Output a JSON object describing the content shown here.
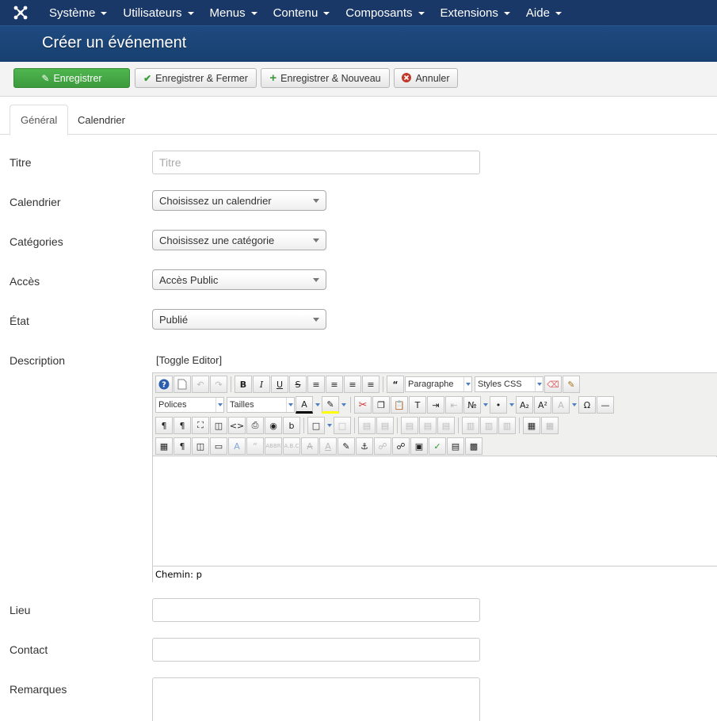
{
  "nav": {
    "items": [
      {
        "label": "Système"
      },
      {
        "label": "Utilisateurs"
      },
      {
        "label": "Menus"
      },
      {
        "label": "Contenu"
      },
      {
        "label": "Composants"
      },
      {
        "label": "Extensions"
      },
      {
        "label": "Aide"
      }
    ]
  },
  "page_title": "Créer un événement",
  "toolbar": {
    "save": "Enregistrer",
    "save_close": "Enregistrer & Fermer",
    "save_new": "Enregistrer & Nouveau",
    "cancel": "Annuler"
  },
  "tabs": [
    {
      "label": "Général",
      "active": true
    },
    {
      "label": "Calendrier",
      "active": false
    }
  ],
  "form": {
    "title": {
      "label": "Titre",
      "value": "",
      "placeholder": "Titre"
    },
    "calendar": {
      "label": "Calendrier",
      "value": "Choisissez un calendrier"
    },
    "categories": {
      "label": "Catégories",
      "value": "Choisissez une catégorie"
    },
    "access": {
      "label": "Accès",
      "value": "Accès Public"
    },
    "state": {
      "label": "État",
      "value": "Publié"
    },
    "description": {
      "label": "Description",
      "toggle": "[Toggle Editor]"
    },
    "location": {
      "label": "Lieu",
      "value": ""
    },
    "contact": {
      "label": "Contact",
      "value": ""
    },
    "remarks": {
      "label": "Remarques",
      "value": ""
    }
  },
  "editor": {
    "format_select": "Paragraphe",
    "styles_select": "Styles CSS",
    "fonts_select": "Polices",
    "sizes_select": "Tailles",
    "path": "Chemin: p"
  },
  "colors": {
    "nav_bg": "#1a3867",
    "title_bg": "#1f4a80",
    "save_green": "#46a546",
    "cancel_red": "#c0392b"
  }
}
